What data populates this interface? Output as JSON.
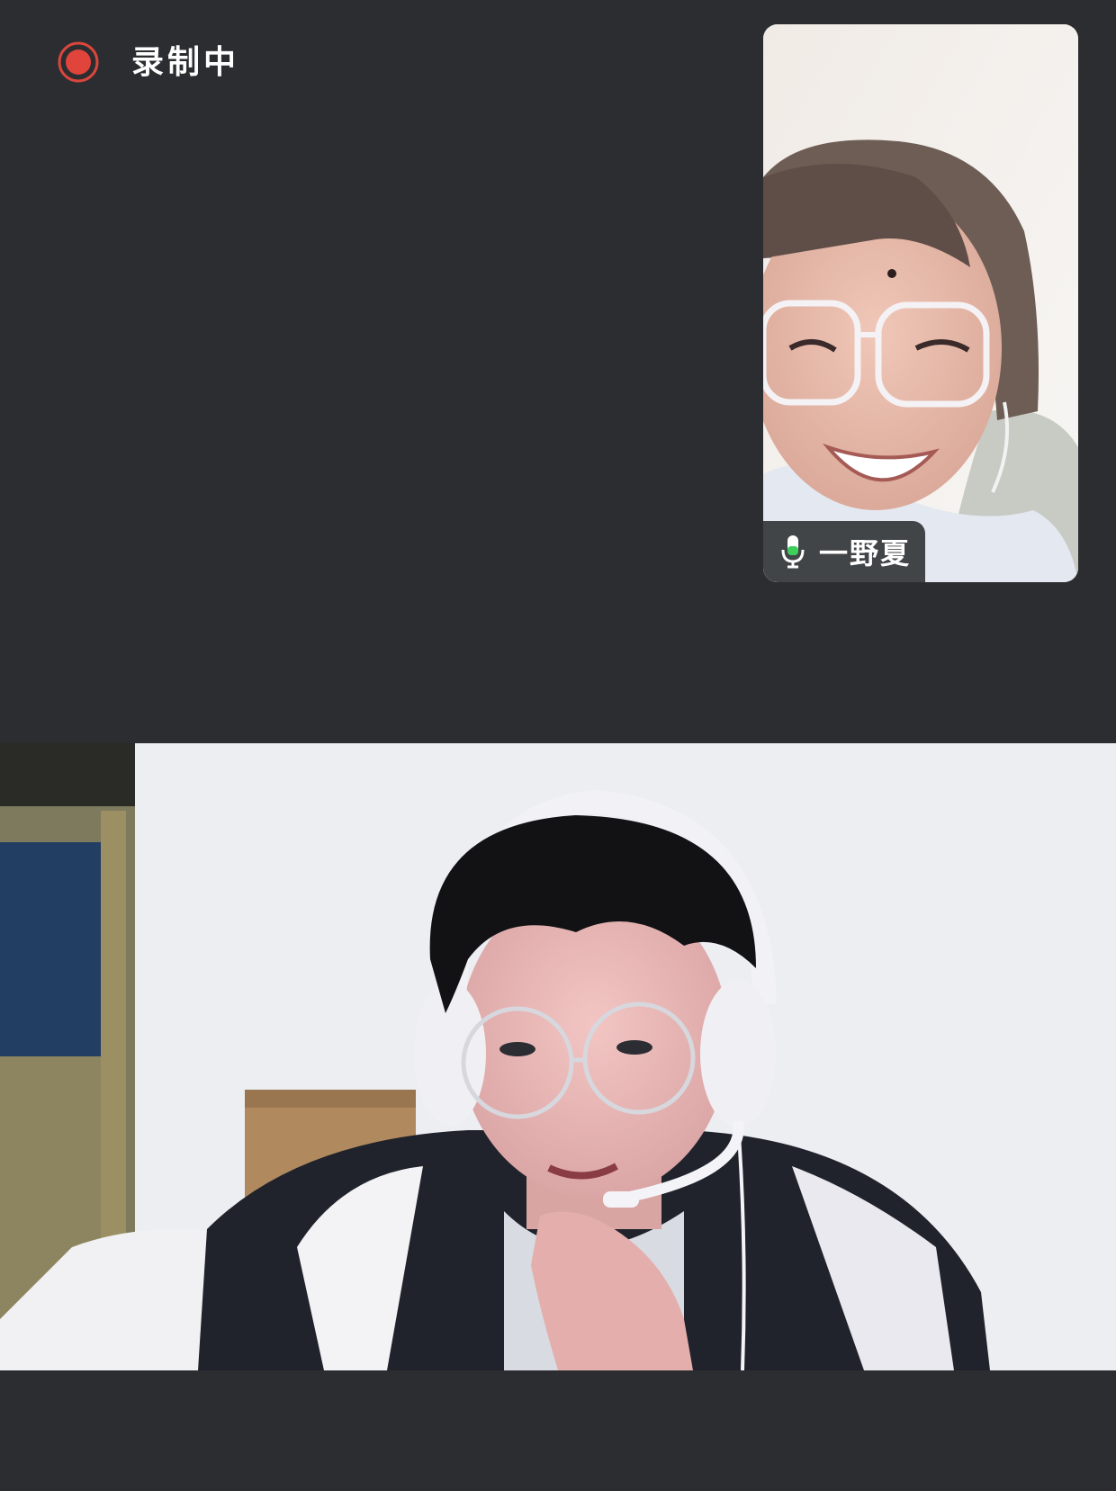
{
  "recording": {
    "label": "录制中",
    "icon": "record-icon",
    "color": "#e0443a"
  },
  "remote_participant": {
    "name": "一野夏",
    "mic_status": "on",
    "mic_icon": "microphone-icon",
    "mic_color": "#3ecf5a"
  },
  "local_participant": {
    "video": "camera-feed"
  },
  "colors": {
    "background": "#2c2d30",
    "name_tag_background": "#34363a"
  }
}
